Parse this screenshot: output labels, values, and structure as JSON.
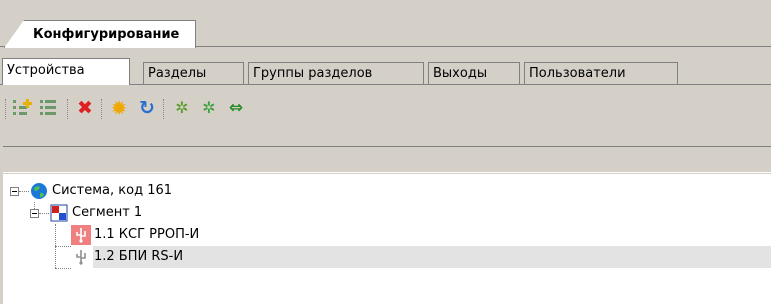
{
  "main_tab": {
    "label": "Конфигурирование"
  },
  "sub_tabs": [
    {
      "label": "Устройства",
      "active": true
    },
    {
      "label": "Разделы",
      "active": false
    },
    {
      "label": "Группы разделов",
      "active": false
    },
    {
      "label": "Выходы",
      "active": false
    },
    {
      "label": "Пользователи",
      "active": false
    }
  ],
  "toolbar": {
    "buttons": [
      {
        "icon": "add-child-icon",
        "glyph": "⊞"
      },
      {
        "icon": "add-sibling-icon",
        "glyph": "☰"
      },
      {
        "icon": "delete-icon",
        "glyph": "✖"
      },
      {
        "icon": "sun-icon",
        "glyph": "✹"
      },
      {
        "icon": "refresh-sun-icon",
        "glyph": "↻"
      },
      {
        "icon": "gear-dots-icon",
        "glyph": "✲"
      },
      {
        "icon": "gear-dots-green-icon",
        "glyph": "✲"
      },
      {
        "icon": "exchange-arrows-icon",
        "glyph": "⇔"
      }
    ]
  },
  "tree": {
    "nodes": [
      {
        "label": "Система, код 161",
        "level": 0,
        "icon": "globe-icon",
        "expanded": true
      },
      {
        "label": "Сегмент 1",
        "level": 1,
        "icon": "segment-icon",
        "expanded": true
      },
      {
        "label": "1.1 КСГ РРОП-И",
        "level": 2,
        "icon": "usb-red-icon",
        "selected": false
      },
      {
        "label": "1.2 БПИ RS-И",
        "level": 2,
        "icon": "usb-gray-icon",
        "selected": true
      }
    ]
  },
  "colors": {
    "panel": "#d4d0c8",
    "selected_row": "#e3e3e3",
    "delete": "#e02020",
    "globe": "#1a78d8"
  }
}
